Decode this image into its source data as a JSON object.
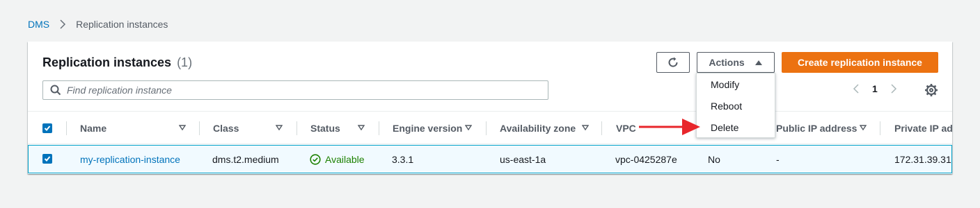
{
  "breadcrumb": {
    "root": "DMS",
    "current": "Replication instances"
  },
  "header": {
    "title": "Replication instances",
    "count": "(1)"
  },
  "search": {
    "placeholder": "Find replication instance",
    "value": ""
  },
  "toolbar": {
    "actions_label": "Actions",
    "create_label": "Create replication instance"
  },
  "pagination": {
    "current_page": "1"
  },
  "actions_menu": {
    "items": [
      "Modify",
      "Reboot",
      "Delete"
    ]
  },
  "table": {
    "columns": [
      "Name",
      "Class",
      "Status",
      "Engine version",
      "Availability zone",
      "VPC",
      "",
      "Public IP address",
      "Private IP ad"
    ],
    "rows": [
      {
        "name": "my-replication-instance",
        "class": "dms.t2.medium",
        "status": "Available",
        "engine_version": "3.3.1",
        "availability_zone": "us-east-1a",
        "vpc": "vpc-0425287e",
        "publicly_accessible": "No",
        "public_ip": "-",
        "private_ip": "172.31.39.31"
      }
    ]
  },
  "colors": {
    "link": "#0073bb",
    "primary": "#ec7211",
    "success": "#1d8102",
    "annotation_arrow": "#e8262b"
  }
}
